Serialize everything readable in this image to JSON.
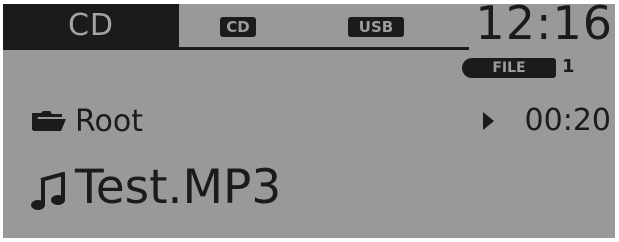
{
  "display": {
    "mode": "CD",
    "sources": {
      "cd": "CD",
      "usb": "USB"
    },
    "clock": "12:16",
    "file": {
      "label": "FILE",
      "number": "1"
    },
    "folder": {
      "icon": "folder-icon",
      "name": "Root"
    },
    "elapsed": {
      "icon": "play-icon",
      "time": "00:20"
    },
    "track": {
      "icon": "music-note-icon",
      "name": "Test.MP3"
    }
  },
  "colors": {
    "screen_background": "#999999",
    "segment_dark": "#1b1b1b",
    "inverted_text": "#a3a3a3"
  }
}
